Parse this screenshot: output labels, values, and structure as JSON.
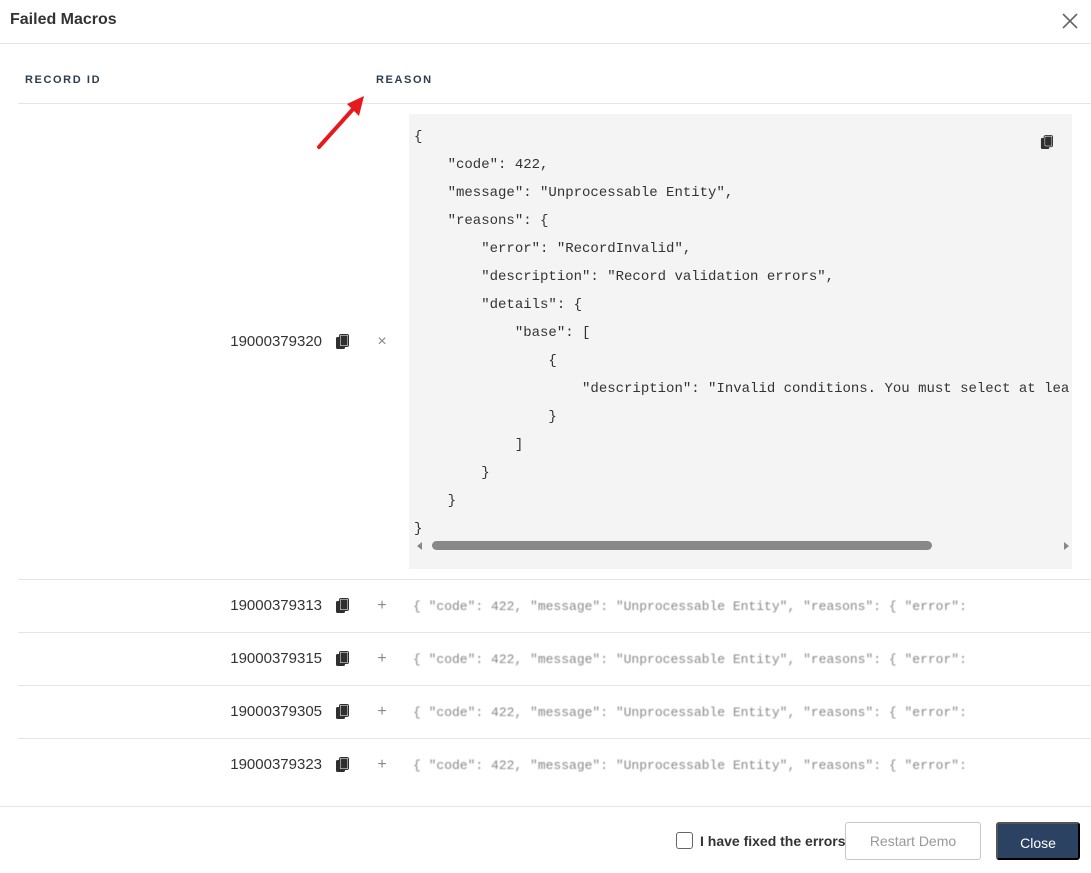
{
  "dialog": {
    "title": "Failed Macros",
    "close_icon": "close-icon"
  },
  "table": {
    "headers": {
      "record_id": "RECORD ID",
      "reason": "REASON"
    },
    "rows": [
      {
        "record_id": "19000379320",
        "expanded": true,
        "toggle": "×",
        "code_lines": [
          "{",
          "    \"code\": 422,",
          "    \"message\": \"Unprocessable Entity\",",
          "    \"reasons\": {",
          "        \"error\": \"RecordInvalid\",",
          "        \"description\": \"Record validation errors\",",
          "        \"details\": {",
          "            \"base\": [",
          "                {",
          "                    \"description\": \"Invalid conditions. You must select at lea",
          "                }",
          "            ]",
          "        }",
          "    }",
          "}"
        ]
      },
      {
        "record_id": "19000379313",
        "expanded": false,
        "toggle": "+",
        "preview": "{ \"code\": 422, \"message\": \"Unprocessable Entity\", \"reasons\": { \"error\":"
      },
      {
        "record_id": "19000379315",
        "expanded": false,
        "toggle": "+",
        "preview": "{ \"code\": 422, \"message\": \"Unprocessable Entity\", \"reasons\": { \"error\":"
      },
      {
        "record_id": "19000379305",
        "expanded": false,
        "toggle": "+",
        "preview": "{ \"code\": 422, \"message\": \"Unprocessable Entity\", \"reasons\": { \"error\":"
      },
      {
        "record_id": "19000379323",
        "expanded": false,
        "toggle": "+",
        "preview": "{ \"code\": 422, \"message\": \"Unprocessable Entity\", \"reasons\": { \"error\":"
      }
    ]
  },
  "footer": {
    "checkbox_label": "I have fixed the errors",
    "checkbox_checked": false,
    "restart_label": "Restart Demo",
    "close_label": "Close"
  },
  "colors": {
    "accent": "#2c4263",
    "annotation": "#e8191c",
    "code_background": "#f4f4f4"
  },
  "icons": {
    "copy": "copy-icon",
    "annotation": "red-arrow-icon"
  }
}
